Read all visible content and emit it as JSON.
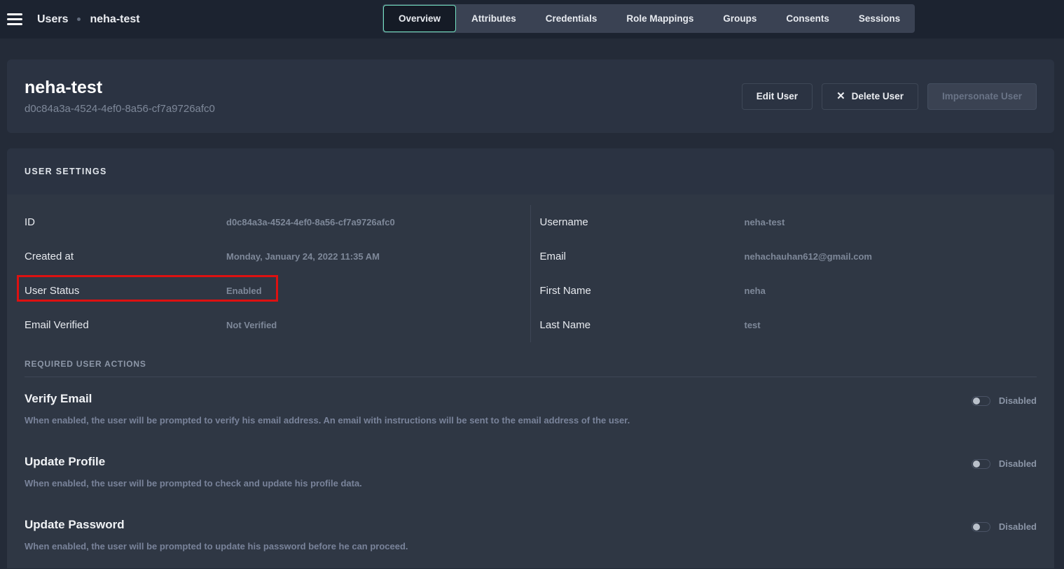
{
  "topbar": {
    "breadcrumb": {
      "root": "Users",
      "current": "neha-test"
    },
    "tabs": [
      {
        "label": "Overview",
        "active": true
      },
      {
        "label": "Attributes",
        "active": false
      },
      {
        "label": "Credentials",
        "active": false
      },
      {
        "label": "Role Mappings",
        "active": false
      },
      {
        "label": "Groups",
        "active": false
      },
      {
        "label": "Consents",
        "active": false
      },
      {
        "label": "Sessions",
        "active": false
      }
    ]
  },
  "profile": {
    "title": "neha-test",
    "user_id": "d0c84a3a-4524-4ef0-8a56-cf7a9726afc0",
    "buttons": {
      "edit": "Edit User",
      "delete": "Delete User",
      "delete_icon": "✕",
      "impersonate": "Impersonate User"
    }
  },
  "user_settings": {
    "title": "USER SETTINGS",
    "left_fields": [
      {
        "label": "ID",
        "value": "d0c84a3a-4524-4ef0-8a56-cf7a9726afc0"
      },
      {
        "label": "Created at",
        "value": "Monday, January 24, 2022 11:35 AM"
      },
      {
        "label": "User Status",
        "value": "Enabled",
        "highlighted": true
      },
      {
        "label": "Email Verified",
        "value": "Not Verified"
      }
    ],
    "right_fields": [
      {
        "label": "Username",
        "value": "neha-test"
      },
      {
        "label": "Email",
        "value": "nehachauhan612@gmail.com"
      },
      {
        "label": "First Name",
        "value": "neha"
      },
      {
        "label": "Last Name",
        "value": "test"
      }
    ]
  },
  "required_actions": {
    "title": "REQUIRED USER ACTIONS",
    "items": [
      {
        "title": "Verify Email",
        "description": "When enabled, the user will be prompted to verify his email address. An email with instructions will be sent to the email address of the user.",
        "state": "Disabled",
        "enabled": false
      },
      {
        "title": "Update Profile",
        "description": "When enabled, the user will be prompted to check and update his profile data.",
        "state": "Disabled",
        "enabled": false
      },
      {
        "title": "Update Password",
        "description": "When enabled, the user will be prompted to update his password before he can proceed.",
        "state": "Disabled",
        "enabled": false
      }
    ]
  },
  "colors": {
    "active_tab_border": "#74e3c3",
    "highlight_red": "#dd1111",
    "topbar_bg": "#1c2330",
    "page_bg": "#242b38",
    "card_bg": "#2b3342",
    "section_body_bg": "#2f3744"
  }
}
